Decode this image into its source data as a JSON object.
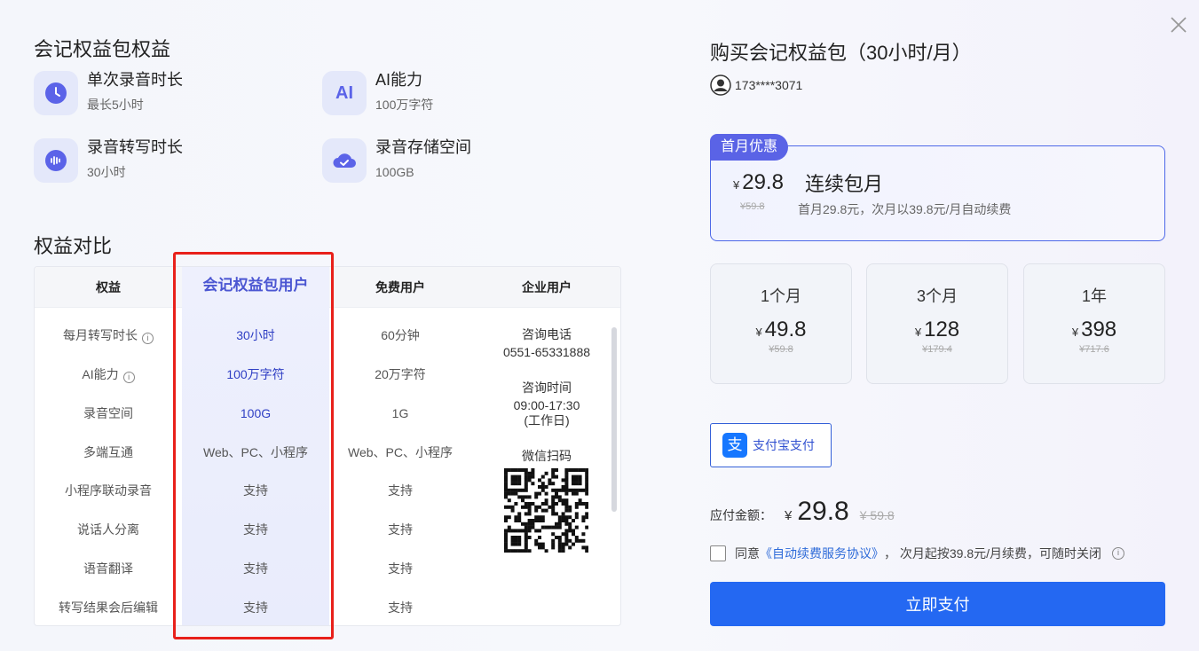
{
  "left": {
    "benefits_title": "会记权益包权益",
    "benefits": [
      {
        "icon": "clock-icon",
        "icon_text": "",
        "title": "单次录音时长",
        "desc": "最长5小时"
      },
      {
        "icon": "ai-icon",
        "icon_text": "AI",
        "title": "AI能力",
        "desc": "100万字符"
      },
      {
        "icon": "waveform-icon",
        "icon_text": "",
        "title": "录音转写时长",
        "desc": "30小时"
      },
      {
        "icon": "cloud-check-icon",
        "icon_text": "",
        "title": "录音存储空间",
        "desc": "100GB"
      }
    ],
    "compare_title": "权益对比",
    "compare": {
      "headers": [
        "权益",
        "会记权益包用户",
        "免费用户",
        "企业用户"
      ],
      "rows": [
        {
          "name": "每月转写时长",
          "info": true,
          "pkg": "30小时",
          "free": "60分钟"
        },
        {
          "name": "AI能力",
          "info": true,
          "pkg": "100万字符",
          "free": "20万字符"
        },
        {
          "name": "录音空间",
          "info": false,
          "pkg": "100G",
          "free": "1G"
        },
        {
          "name": "多端互通",
          "info": false,
          "pkg": "Web、PC、小程序",
          "free": "Web、PC、小程序"
        },
        {
          "name": "小程序联动录音",
          "info": false,
          "pkg": "支持",
          "free": "支持"
        },
        {
          "name": "说话人分离",
          "info": false,
          "pkg": "支持",
          "free": "支持"
        },
        {
          "name": "语音翻译",
          "info": false,
          "pkg": "支持",
          "free": "支持"
        },
        {
          "name": "转写结果会后编辑",
          "info": false,
          "pkg": "支持",
          "free": "支持"
        }
      ],
      "enterprise": {
        "phone_label": "咨询电话",
        "phone": "0551-65331888",
        "time_label": "咨询时间",
        "time": "09:00-17:30",
        "time_note": "(工作日)",
        "wechat_label": "微信扫码"
      },
      "info_glyph": "i"
    }
  },
  "right": {
    "title": "购买会记权益包（30小时/月）",
    "user": "173****3071",
    "featured": {
      "badge": "首月优惠",
      "yen": "¥",
      "price": "29.8",
      "orig": "¥59.8",
      "name": "连续包月",
      "desc": "首月29.8元，次月以39.8元/月自动续费"
    },
    "plans": [
      {
        "name": "1个月",
        "price": "49.8",
        "orig": "¥59.8"
      },
      {
        "name": "3个月",
        "price": "128",
        "orig": "¥179.4"
      },
      {
        "name": "1年",
        "price": "398",
        "orig": "¥717.6"
      }
    ],
    "yen": "¥",
    "alipay": {
      "logo": "支",
      "label": "支付宝支付"
    },
    "amount": {
      "label": "应付金额：",
      "yen": "¥",
      "value": "29.8",
      "orig": "¥ 59.8"
    },
    "agree": {
      "prefix": "同意",
      "link": "《自动续费服务协议》",
      "suffix": "，  次月起按39.8元/月续费，可随时关闭"
    },
    "pay_button": "立即支付"
  },
  "colors": {
    "accent": "#5a63e6",
    "primary": "#2468f2",
    "highlight": "#e9ecfc",
    "annotation": "#e8201a"
  }
}
